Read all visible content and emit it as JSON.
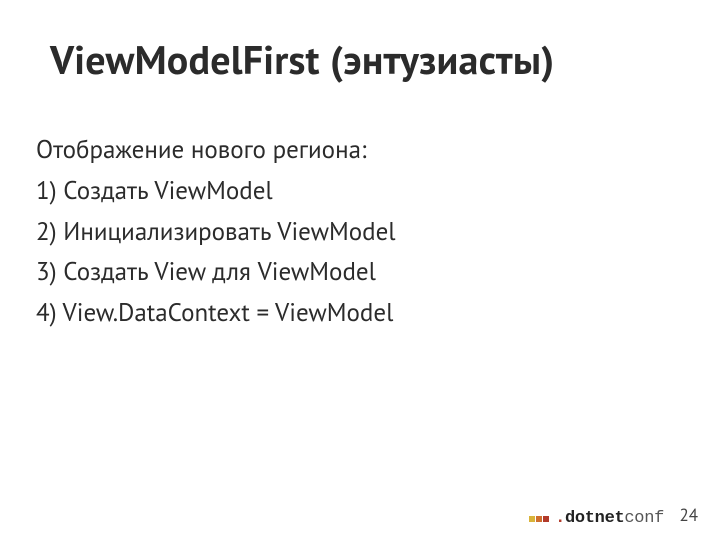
{
  "title": "ViewModelFirst (энтузиасты)",
  "intro": "Отображение нового региона:",
  "steps": [
    "1) Создать ViewModel",
    "2) Инициализировать ViewModel",
    "3) Создать View для ViewModel",
    "4) View.DataContext = ViewModel"
  ],
  "brand": {
    "dot": ".",
    "name": "dotnet",
    "suffix": "conf"
  },
  "page_number": "24"
}
